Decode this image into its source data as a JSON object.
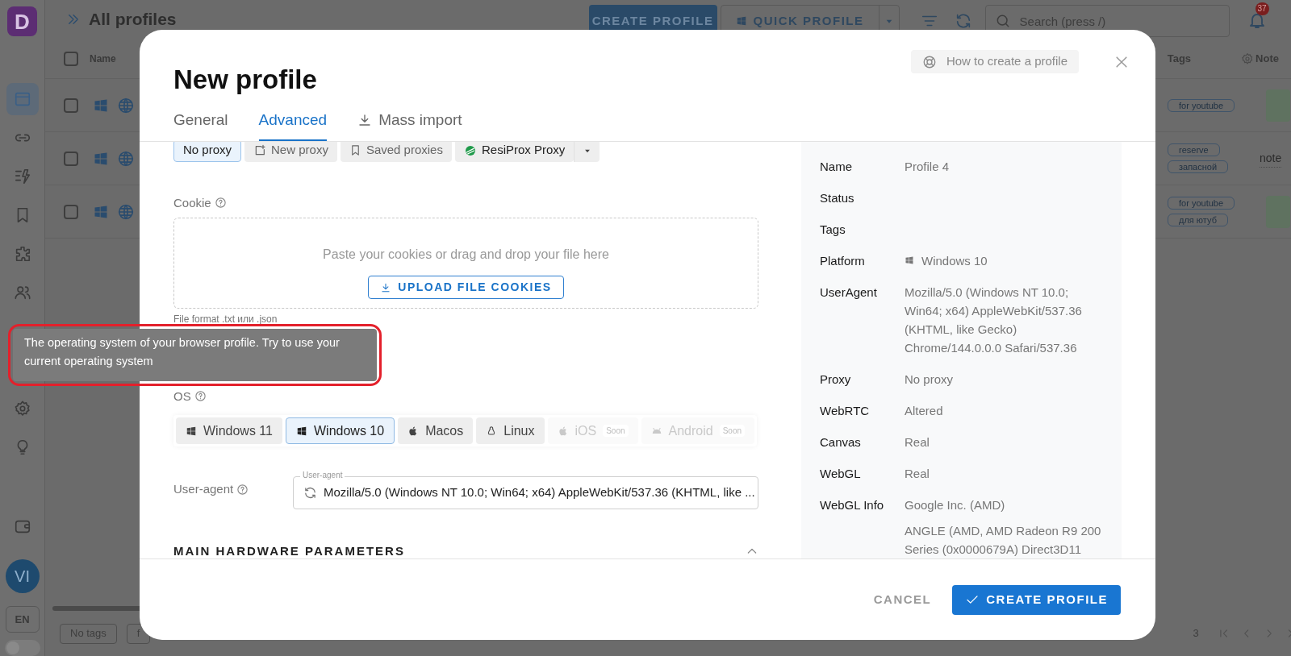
{
  "app": {
    "logo": "D",
    "title": "All profiles",
    "create_button": "CREATE PROFILE",
    "quick_button": "QUICK PROFILE",
    "search": {
      "placeholder": "Search (press /)"
    },
    "notification_count": "37",
    "nav": [
      {
        "kind": "browser",
        "selected": true
      },
      {
        "kind": "link",
        "selected": false
      },
      {
        "kind": "automation",
        "selected": false
      },
      {
        "kind": "bookmark",
        "selected": false
      },
      {
        "kind": "extension",
        "selected": false
      },
      {
        "kind": "users",
        "selected": false
      }
    ],
    "nav_lower": [
      {
        "kind": "settings",
        "selected": false
      },
      {
        "kind": "bulb",
        "selected": false
      }
    ],
    "avatar": "VI",
    "language": "EN",
    "dark_mode": false,
    "select_all_checked": false,
    "columns": [
      "Name",
      "Tags",
      "Note"
    ],
    "rows": [
      {
        "checked": false,
        "tags": [
          "for youtube"
        ]
      },
      {
        "checked": false,
        "tags": [
          "reserve",
          "запасной"
        ],
        "note": "note"
      },
      {
        "checked": false,
        "tags": [
          "for youtube",
          "для ютуб"
        ]
      }
    ],
    "tag_filters": [
      "No tags",
      "f"
    ],
    "page": "3"
  },
  "modal": {
    "title": "New profile",
    "help_link": "How to create a profile",
    "tabs": [
      {
        "label": "General",
        "selected": false
      },
      {
        "label": "Advanced",
        "selected": true
      },
      {
        "label": "Mass import",
        "selected": false,
        "kind": "import"
      }
    ],
    "proxy_options": [
      {
        "label": "No proxy",
        "selected": true,
        "kind": "plain"
      },
      {
        "label": "New proxy",
        "selected": false,
        "kind": "new"
      },
      {
        "label": "Saved proxies",
        "selected": false,
        "kind": "saved"
      },
      {
        "label": "ResiProx Proxy",
        "selected": false,
        "kind": "provider"
      }
    ],
    "cookie": {
      "label": "Cookie",
      "placeholder": "Paste your cookies or drag and drop your file here",
      "upload_button": "UPLOAD FILE COOKIES",
      "hint": "File format .txt или .json"
    },
    "tooltip": "The operating system of your browser profile. Try to use your current operating system",
    "os": {
      "label": "OS",
      "options": [
        {
          "label": "Windows 11",
          "kind": "windows",
          "selected": false,
          "disabled": false
        },
        {
          "label": "Windows 10",
          "kind": "windows",
          "selected": true,
          "disabled": false
        },
        {
          "label": "Macos",
          "kind": "apple",
          "selected": false,
          "disabled": false
        },
        {
          "label": "Linux",
          "kind": "linux",
          "selected": false,
          "disabled": false
        },
        {
          "label": "iOS",
          "kind": "apple",
          "selected": false,
          "disabled": true,
          "badge": "Soon"
        },
        {
          "label": "Android",
          "kind": "android",
          "selected": false,
          "disabled": true,
          "badge": "Soon"
        }
      ]
    },
    "user_agent": {
      "label": "User-agent",
      "legend": "User-agent",
      "value": "Mozilla/5.0 (Windows NT 10.0; Win64; x64) AppleWebKit/537.36 (KHTML, like ..."
    },
    "section": {
      "title": "MAIN HARDWARE PARAMETERS",
      "expanded": true
    },
    "summary": [
      {
        "label": "Name",
        "values": [
          "Profile 4"
        ]
      },
      {
        "label": "Status"
      },
      {
        "label": "Tags"
      },
      {
        "label": "Platform",
        "values": [
          "Windows 10"
        ],
        "kind": "windows"
      },
      {
        "label": "UserAgent",
        "values": [
          "Mozilla/5.0 (Windows NT 10.0; Win64; x64) AppleWebKit/537.36 (KHTML, like Gecko) Chrome/144.0.0.0 Safari/537.36"
        ]
      },
      {
        "label": "Proxy",
        "values": [
          "No proxy"
        ]
      },
      {
        "label": "WebRTC",
        "values": [
          "Altered"
        ]
      },
      {
        "label": "Canvas",
        "values": [
          "Real"
        ]
      },
      {
        "label": "WebGL",
        "values": [
          "Real"
        ]
      },
      {
        "label": "WebGL Info",
        "values": [
          "Google Inc. (AMD)",
          "ANGLE (AMD, AMD Radeon R9 200 Series (0x0000679A) Direct3D11"
        ]
      }
    ],
    "cancel_button": "CANCEL",
    "create_button": "CREATE PROFILE"
  }
}
